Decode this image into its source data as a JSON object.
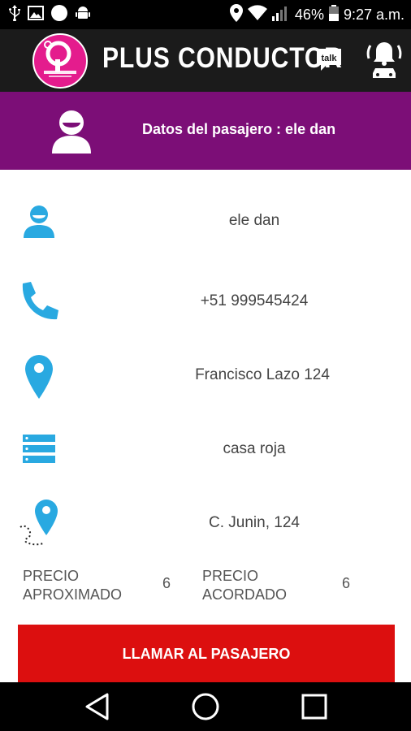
{
  "status_bar": {
    "battery": "46%",
    "time": "9:27 a.m."
  },
  "header": {
    "app_title": "PLUS CONDUCTOR",
    "logo_text": "PLUS CONDUCTOR",
    "talk_label": "talk"
  },
  "banner": {
    "title": "Datos del pasajero : ele dan"
  },
  "details": {
    "name": "ele dan",
    "phone": "+51 999545424",
    "address": "Francisco Lazo 124",
    "reference": "casa roja",
    "destination": "C. Junin, 124"
  },
  "price": {
    "approx_label_1": "PRECIO",
    "approx_label_2": "APROXIMADO",
    "approx_value": "6",
    "agreed_label_1": "PRECIO",
    "agreed_label_2": "ACORDADO",
    "agreed_value": "6"
  },
  "actions": {
    "call_label": "LLAMAR AL PASAJERO"
  },
  "colors": {
    "accent_blue": "#29a9e1",
    "banner_purple": "#7c0e77",
    "call_red": "#dc0f0f",
    "logo_pink": "#e41c8d"
  }
}
